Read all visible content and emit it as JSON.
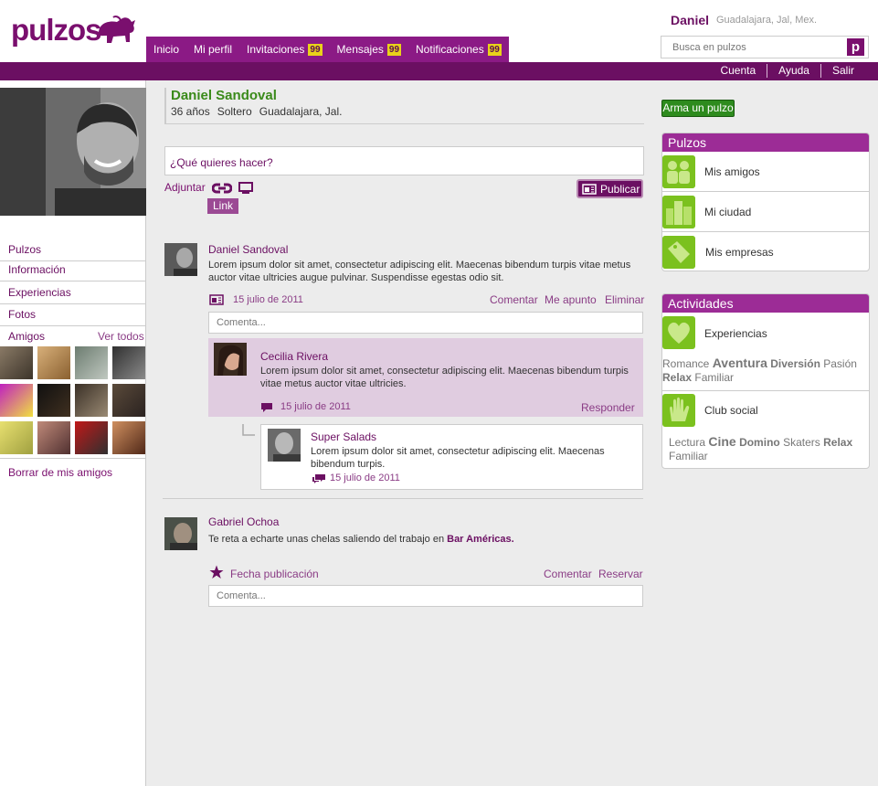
{
  "brand": {
    "name": "pulzos"
  },
  "nav": {
    "items": [
      {
        "label": "Inicio",
        "badge": ""
      },
      {
        "label": "Mi perfil",
        "badge": ""
      },
      {
        "label": "Invitaciones",
        "badge": "99"
      },
      {
        "label": "Mensajes",
        "badge": "99"
      },
      {
        "label": "Notificaciones",
        "badge": "99"
      }
    ]
  },
  "user": {
    "name": "Daniel",
    "location": "Guadalajara, Jal, Mex."
  },
  "search": {
    "placeholder": "Busca en pulzos",
    "button": "p"
  },
  "top_links": [
    "Cuenta",
    "Ayuda",
    "Salir"
  ],
  "sidebar": {
    "menu": [
      "Pulzos",
      "Información",
      "Experiencias",
      "Fotos"
    ],
    "friends_label": "Amigos",
    "see_all": "Ver todos",
    "delete_friends": "Borrar  de mis amigos"
  },
  "profile": {
    "name": "Daniel Sandoval",
    "age": "36 años",
    "status": "Soltero",
    "city": "Guadalajara, Jal."
  },
  "arma_button": "Arma un pulzo",
  "composer": {
    "placeholder": "¿Qué quieres hacer?",
    "attach": "Adjuntar",
    "link_tip": "Link",
    "publish": "Publicar"
  },
  "posts": [
    {
      "author": "Daniel Sandoval",
      "text": "Lorem ipsum dolor sit amet, consectetur adipiscing elit. Maecenas bibendum turpis vitae metus auctor vitae ultricies augue pulvinar. Suspendisse egestas odio sit.",
      "date": "15 julio de 2011",
      "actions": [
        "Comentar",
        "Me apunto",
        "Eliminar"
      ],
      "comment_placeholder": "Comenta...",
      "comments": [
        {
          "author": "Cecilia Rivera",
          "text": "Lorem ipsum dolor sit amet, consectetur adipiscing elit. Maecenas bibendum turpis vitae metus auctor vitae ultricies.",
          "date": "15 julio de 2011",
          "reply_label": "Responder",
          "replies": [
            {
              "author": "Super Salads",
              "text": "Lorem ipsum dolor sit amet, consectetur adipiscing elit. Maecenas bibendum turpis.",
              "date": "15 julio de 2011"
            }
          ]
        }
      ]
    },
    {
      "author": "Gabriel Ochoa",
      "text_prefix": "Te reta a echarte unas chelas saliendo del trabajo en",
      "place": "Bar Américas.",
      "date_label": "Fecha publicación",
      "actions": [
        "Comentar",
        "Reservar"
      ],
      "comment_placeholder": "Comenta..."
    }
  ],
  "right": {
    "pulzos": {
      "title": "Pulzos",
      "items": [
        "Mis amigos",
        "Mi ciudad",
        "Mis empresas"
      ]
    },
    "actividades": {
      "title": "Actividades",
      "groups": [
        {
          "label": "Experiencias",
          "tags": [
            "Romance",
            "Aventura",
            "Diversión",
            "Pasión",
            "Relax",
            "Familiar"
          ]
        },
        {
          "label": "Club social",
          "tags": [
            "Lectura",
            "Cine",
            "Domino",
            "Skaters",
            "Relax",
            "Familiar"
          ]
        }
      ]
    }
  },
  "colors": {
    "brand": "#6b0f62",
    "accent_green": "#3a8a1a",
    "badge": "#e8d21a",
    "panel_header": "#9c2c96"
  }
}
